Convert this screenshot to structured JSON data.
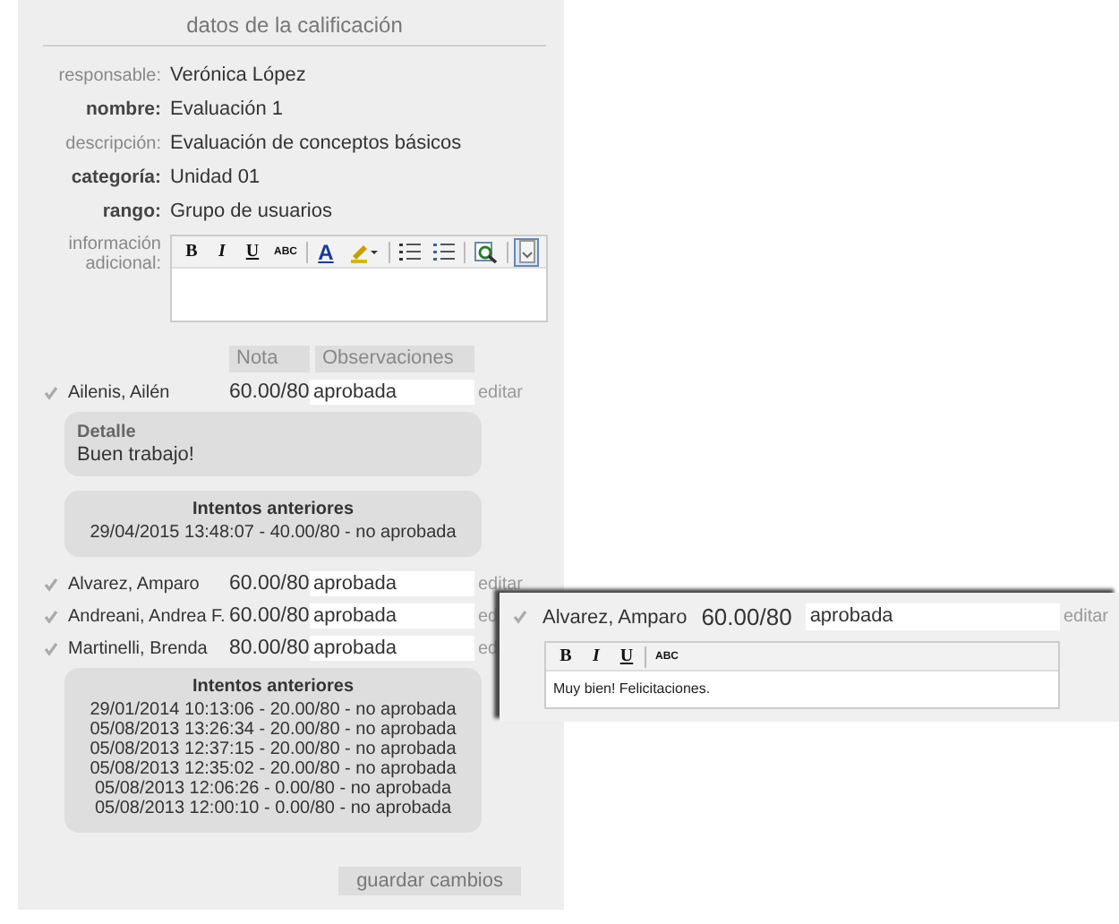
{
  "panel_title": "datos de la calificación",
  "fields": [
    {
      "label": "responsable:",
      "value": "Verónica López",
      "emphasis": false
    },
    {
      "label": "nombre:",
      "value": "Evaluación 1",
      "emphasis": true
    },
    {
      "label": "descripción:",
      "value": "Evaluación de conceptos básicos",
      "emphasis": false
    },
    {
      "label": "categoría:",
      "value": "Unidad 01",
      "emphasis": true
    },
    {
      "label": "rango:",
      "value": "Grupo de usuarios",
      "emphasis": true
    }
  ],
  "additional_info": {
    "label": "información adicional:",
    "toolbar": [
      {
        "kind": "bold",
        "label": "B",
        "selected": false
      },
      {
        "kind": "italic",
        "label": "I",
        "selected": false
      },
      {
        "kind": "underline",
        "label": "U",
        "selected": false
      },
      {
        "kind": "strike",
        "label": "ABC",
        "selected": false
      },
      {
        "kind": "sep"
      },
      {
        "kind": "color",
        "label": "A",
        "selected": false
      },
      {
        "kind": "highlight",
        "selected": false
      },
      {
        "kind": "sep"
      },
      {
        "kind": "bullets",
        "selected": false
      },
      {
        "kind": "numbers",
        "selected": false
      },
      {
        "kind": "sep"
      },
      {
        "kind": "find",
        "selected": false
      },
      {
        "kind": "sep"
      },
      {
        "kind": "collapse",
        "selected": true
      }
    ]
  },
  "columns": [
    "Nota",
    "Observaciones"
  ],
  "students": [
    {
      "checked": true,
      "name": "Ailenis, Ailén",
      "grade": "60.00/80",
      "observation": "aprobada",
      "edit": "editar",
      "detail": {
        "title": "Detalle",
        "text": "Buen trabajo!"
      },
      "attempts": {
        "title": "Intentos anteriores",
        "items": [
          "29/04/2015 13:48:07 - 40.00/80 - no aprobada"
        ]
      }
    },
    {
      "checked": true,
      "name": "Alvarez, Amparo",
      "grade": "60.00/80",
      "observation": "aprobada",
      "edit": "editar"
    },
    {
      "checked": true,
      "name": "Andreani, Andrea F.",
      "grade": "60.00/80",
      "observation": "aprobada",
      "edit": "ed"
    },
    {
      "checked": true,
      "name": "Martinelli, Brenda",
      "grade": "80.00/80",
      "observation": "aprobada",
      "edit": "ed",
      "attempts": {
        "title": "Intentos anteriores",
        "items": [
          "29/01/2014 10:13:06 - 20.00/80 - no aprobada",
          "05/08/2013 13:26:34 - 20.00/80 - no aprobada",
          "05/08/2013 12:37:15 - 20.00/80 - no aprobada",
          "05/08/2013 12:35:02 - 20.00/80 - no aprobada",
          "05/08/2013 12:06:26 - 0.00/80 - no aprobada",
          "05/08/2013 12:00:10 - 0.00/80 - no aprobada"
        ]
      }
    }
  ],
  "save_button": "guardar cambios",
  "zoom_view": {
    "checked": true,
    "name": "Alvarez, Amparo",
    "grade": "60.00/80",
    "observation": "aprobada",
    "edit": "editar",
    "toolbar": [
      {
        "kind": "bold",
        "label": "B"
      },
      {
        "kind": "italic",
        "label": "I"
      },
      {
        "kind": "underline",
        "label": "U"
      },
      {
        "kind": "sep"
      },
      {
        "kind": "strike",
        "label": "ABC"
      }
    ],
    "comment": "Muy bien! Felicitaciones."
  }
}
